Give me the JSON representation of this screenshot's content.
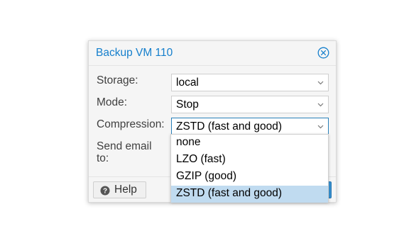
{
  "dialog": {
    "title": "Backup VM 110"
  },
  "fields": {
    "storage": {
      "label": "Storage:",
      "value": "local"
    },
    "mode": {
      "label": "Mode:",
      "value": "Stop"
    },
    "compression": {
      "label": "Compression:",
      "value": "ZSTD (fast and good)"
    },
    "send_email": {
      "label_line1": "Send email",
      "label_line2": "to:"
    }
  },
  "footer": {
    "help_label": "Help"
  },
  "compression_dropdown": {
    "options": [
      "none",
      "LZO (fast)",
      "GZIP (good)",
      "ZSTD (fast and good)"
    ],
    "selected": "ZSTD (fast and good)"
  },
  "colors": {
    "accent": "#157fcc",
    "selected_row": "#c0dbf0",
    "focus_border": "#2980b9"
  },
  "icons": {
    "close": "close-circle-icon",
    "dropdown": "chevron-down-icon",
    "help": "question-circle-icon"
  }
}
